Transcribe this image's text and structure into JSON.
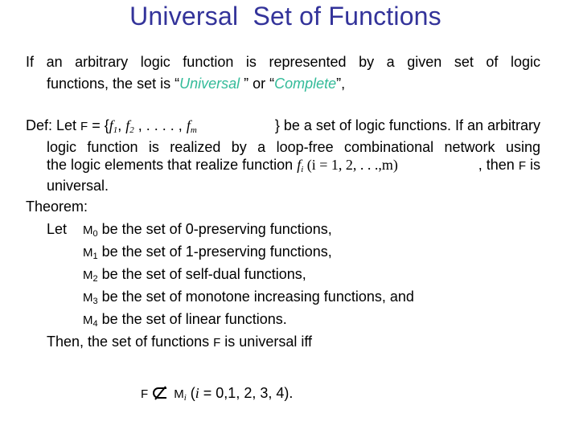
{
  "title": "Universal  Set of Functions",
  "intro": {
    "line1": "If an arbitrary logic function is represented by a given set of logic",
    "line2_pre": "functions, the set is “",
    "universal": "Universal ",
    "line2_mid": "” or  “",
    "complete": "Complete",
    "line2_post": "”,"
  },
  "definition": {
    "prefix": "Def: Let ",
    "F": "F",
    "eq": " = {",
    "f1": "f",
    "f1_sub": "1",
    "comma1": ", ",
    "f2": "f",
    "f2_sub": "2",
    "dots": " , . . . . , ",
    "fm": "f",
    "fm_sub": "m",
    "suffix": " } be a set of logic functions. If an arbitrary",
    "line2": "logic function is realized by a loop-free combinational network using",
    "line3_pre": "the logic elements that realize function ",
    "fi": "f",
    "fi_sub": "i",
    "range": " (i = 1, 2, . . .,m)",
    "line3_post": ", then ",
    "F2": "F",
    "line3_end": " is",
    "line4": "universal."
  },
  "theorem": {
    "heading": "Theorem:",
    "let": "Let",
    "items": [
      {
        "symbol": "M",
        "sub": "0",
        "text": " be the set of 0-preserving functions,"
      },
      {
        "symbol": "M",
        "sub": "1",
        "text": " be the set of 1-preserving functions,"
      },
      {
        "symbol": "M",
        "sub": "2",
        "text": " be the set of self-dual functions,"
      },
      {
        "symbol": "M",
        "sub": "3",
        "text": " be the set of monotone increasing functions, and"
      },
      {
        "symbol": "M",
        "sub": "4",
        "text": " be the set of linear functions."
      }
    ],
    "conclusion_pre": "Then, the set of functions ",
    "conclusion_F": "F",
    "conclusion_post": " is universal iff"
  },
  "condition": {
    "F": "F",
    "symbol": "not-subset",
    "M": "M",
    "sub": "i",
    "open": " (",
    "i": "i",
    "rest": " = 0,1, 2, 3, 4)."
  }
}
